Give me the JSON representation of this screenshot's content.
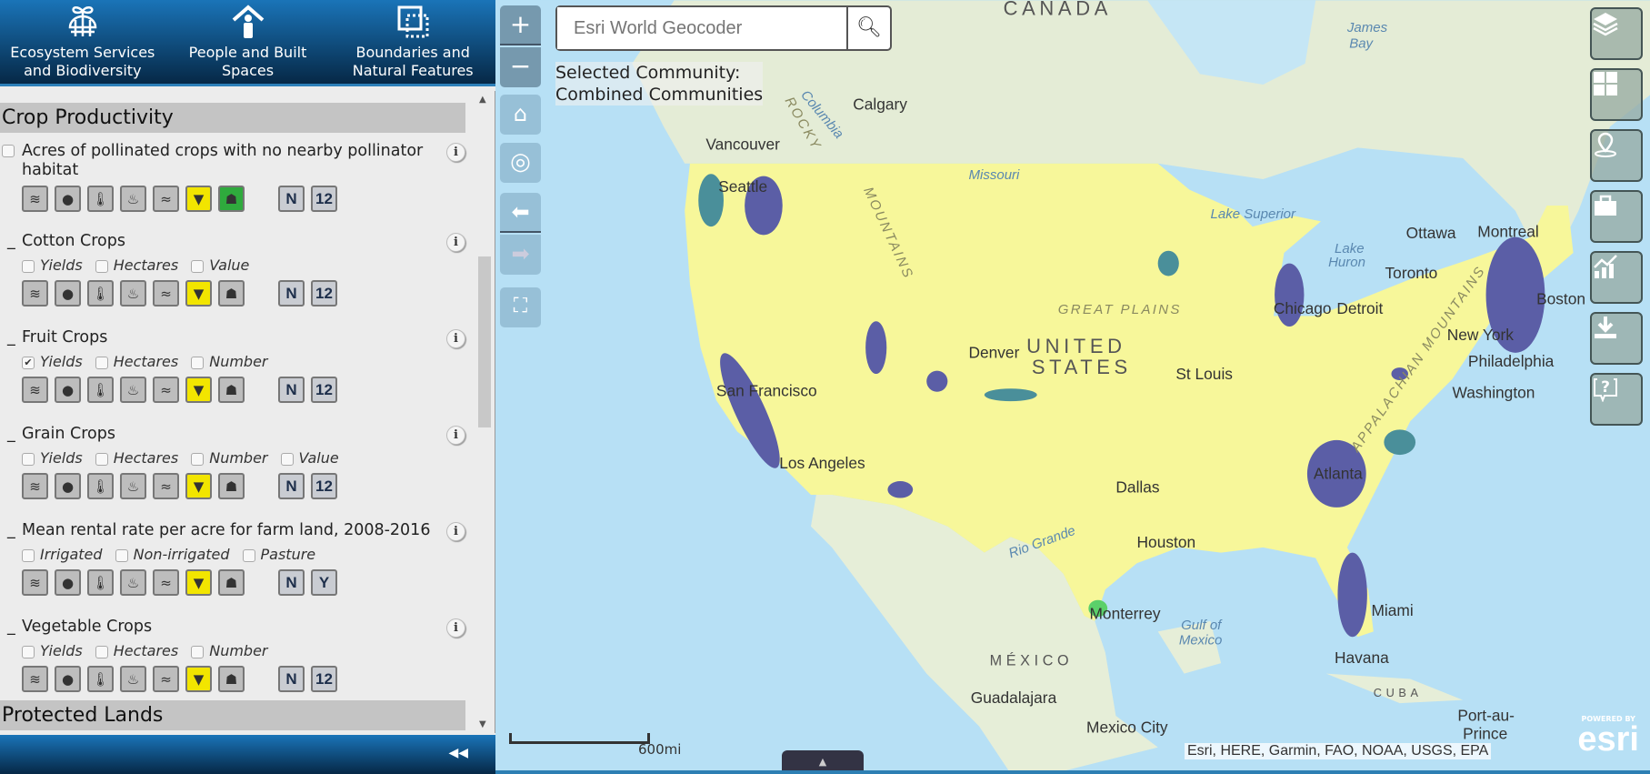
{
  "header": {
    "tabs": [
      {
        "label_line1": "Ecosystem Services",
        "label_line2": "and Biodiversity",
        "icon": "globe-sprout-icon"
      },
      {
        "label_line1": "People and Built",
        "label_line2": "Spaces",
        "icon": "person-house-icon"
      },
      {
        "label_line1": "Boundaries and",
        "label_line2": "Natural Features",
        "icon": "boundary-icon"
      }
    ]
  },
  "sections": [
    {
      "title": "Crop Productivity"
    },
    {
      "title": "Protected Lands"
    }
  ],
  "items": [
    {
      "title": "Acres of pollinated crops with no nearby pollinator habitat",
      "checkbox": true,
      "checked": false,
      "options": [],
      "badge2": "12",
      "turtle_green": true
    },
    {
      "title": "Cotton Crops",
      "options": [
        {
          "label": "Yields",
          "checked": false
        },
        {
          "label": "Hectares",
          "checked": false
        },
        {
          "label": "Value",
          "checked": false
        }
      ],
      "badge2": "12"
    },
    {
      "title": "Fruit Crops",
      "options": [
        {
          "label": "Yields",
          "checked": true
        },
        {
          "label": "Hectares",
          "checked": false
        },
        {
          "label": "Number",
          "checked": false
        }
      ],
      "badge2": "12"
    },
    {
      "title": "Grain Crops",
      "options": [
        {
          "label": "Yields",
          "checked": false
        },
        {
          "label": "Hectares",
          "checked": false
        },
        {
          "label": "Number",
          "checked": false
        },
        {
          "label": "Value",
          "checked": false
        }
      ],
      "badge2": "12"
    },
    {
      "title": "Mean rental rate per acre for farm land, 2008-2016",
      "options": [
        {
          "label": "Irrigated",
          "checked": false
        },
        {
          "label": "Non-irrigated",
          "checked": false
        },
        {
          "label": "Pasture",
          "checked": false
        }
      ],
      "badge2": "Y"
    },
    {
      "title": "Vegetable Crops",
      "options": [
        {
          "label": "Yields",
          "checked": false
        },
        {
          "label": "Hectares",
          "checked": false
        },
        {
          "label": "Number",
          "checked": false
        }
      ],
      "badge2": "12"
    }
  ],
  "badge_n": "N",
  "info_label": "i",
  "service_icons": [
    "wind-icon",
    "water-drop-icon",
    "thermometer-icon",
    "fire-icon",
    "swimmer-icon",
    "corn-icon",
    "turtle-icon"
  ],
  "search": {
    "placeholder": "Esri World Geocoder"
  },
  "selected_community": {
    "line1": "Selected Community:",
    "line2": "Combined Communities"
  },
  "map": {
    "scale_label": "600mi",
    "attribution": "Esri, HERE, Garmin, FAO, NOAA, USGS, EPA",
    "powered_by": "POWERED BY",
    "esri_logo": "esri",
    "labels": {
      "canada": "CANADA",
      "us1": "UNITED",
      "us2": "STATES",
      "mexico": "MÉXICO",
      "cuba": "CUBA",
      "great_plains": "GREAT PLAINS",
      "rocky": "ROCKY",
      "mountains": "MOUNTAINS",
      "appalachian": "APPALACHIAN MOUNTAINS",
      "calgary": "Calgary",
      "vancouver": "Vancouver",
      "seattle": "Seattle",
      "san_francisco": "San Francisco",
      "los_angeles": "Los Angeles",
      "denver": "Denver",
      "dallas": "Dallas",
      "houston": "Houston",
      "st_louis": "St Louis",
      "chicago": "Chicago",
      "detroit": "Detroit",
      "toronto": "Toronto",
      "ottawa": "Ottawa",
      "montreal": "Montreal",
      "boston": "Boston",
      "new_york": "New York",
      "philadelphia": "Philadelphia",
      "washington": "Washington",
      "atlanta": "Atlanta",
      "miami": "Miami",
      "havana": "Havana",
      "monterrey": "Monterrey",
      "guadalajara": "Guadalajara",
      "mexico_city": "Mexico City",
      "port_au_prince1": "Port-au-",
      "port_au_prince2": "Prince",
      "lake_superior": "Lake Superior",
      "lake_huron1": "Lake",
      "lake_huron2": "Huron",
      "james_bay1": "James",
      "james_bay2": "Bay",
      "gulf1": "Gulf of",
      "gulf2": "Mexico",
      "missouri": "Missouri",
      "columbia": "Columbia",
      "rio_grande": "Rio Grande"
    }
  },
  "colors": {
    "header_top": "#1a74b8",
    "header_bottom": "#062846",
    "us_fill": "#f7f79a",
    "purple": "#5b5ea6",
    "green_blob": "#5bd06a",
    "ocean": "#b7e0f5",
    "land": "#e4ecd6"
  }
}
